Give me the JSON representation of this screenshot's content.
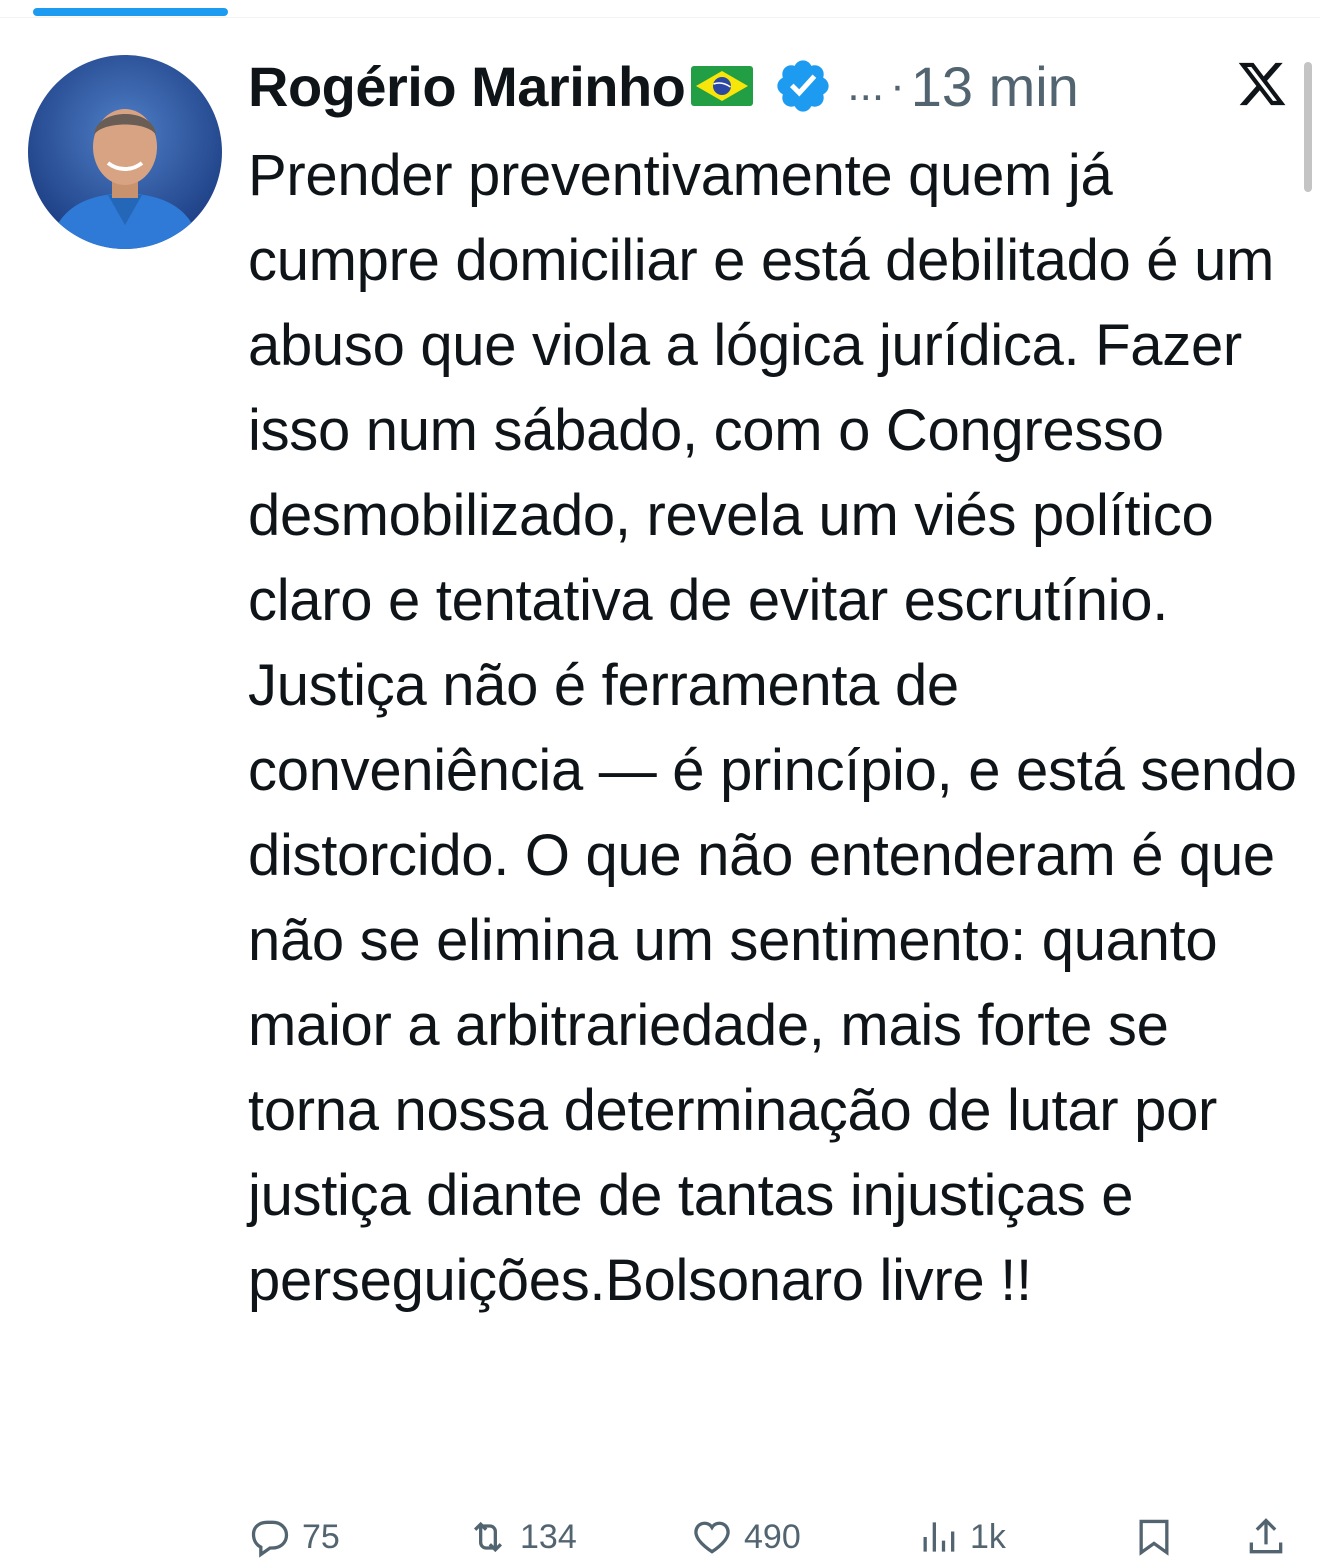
{
  "header": {
    "name": "Rogério Marinho",
    "handle": "...",
    "separator": "·",
    "time": "13 min"
  },
  "tweet": {
    "text": "Prender preventivamente quem já cumpre domiciliar e está debilitado é um abuso que viola a lógica jurídica. Fazer isso num sábado, com o Congresso desmobilizado, revela um viés político claro e tentativa de evitar escrutínio. Justiça não é ferramenta de conveniência — é princípio, e está sendo distorcido. O que não entenderam é que não se elimina um sentimento: quanto maior a arbitrariedade, mais forte se torna nossa determinação de lutar por justiça diante de tantas injustiças e perseguições.Bolsonaro livre !!"
  },
  "actions": {
    "replies": "75",
    "reposts": "134",
    "likes": "490",
    "views": "1k"
  },
  "icons": {
    "verified": "verified-badge-icon",
    "flag": "brazil-flag-icon",
    "logo": "x-logo-icon",
    "reply": "reply-icon",
    "repost": "repost-icon",
    "like": "heart-icon",
    "views": "views-icon",
    "bookmark": "bookmark-icon",
    "share": "share-icon"
  },
  "colors": {
    "accent": "#1d9bf0",
    "text": "#0f1419",
    "secondary": "#536471"
  }
}
